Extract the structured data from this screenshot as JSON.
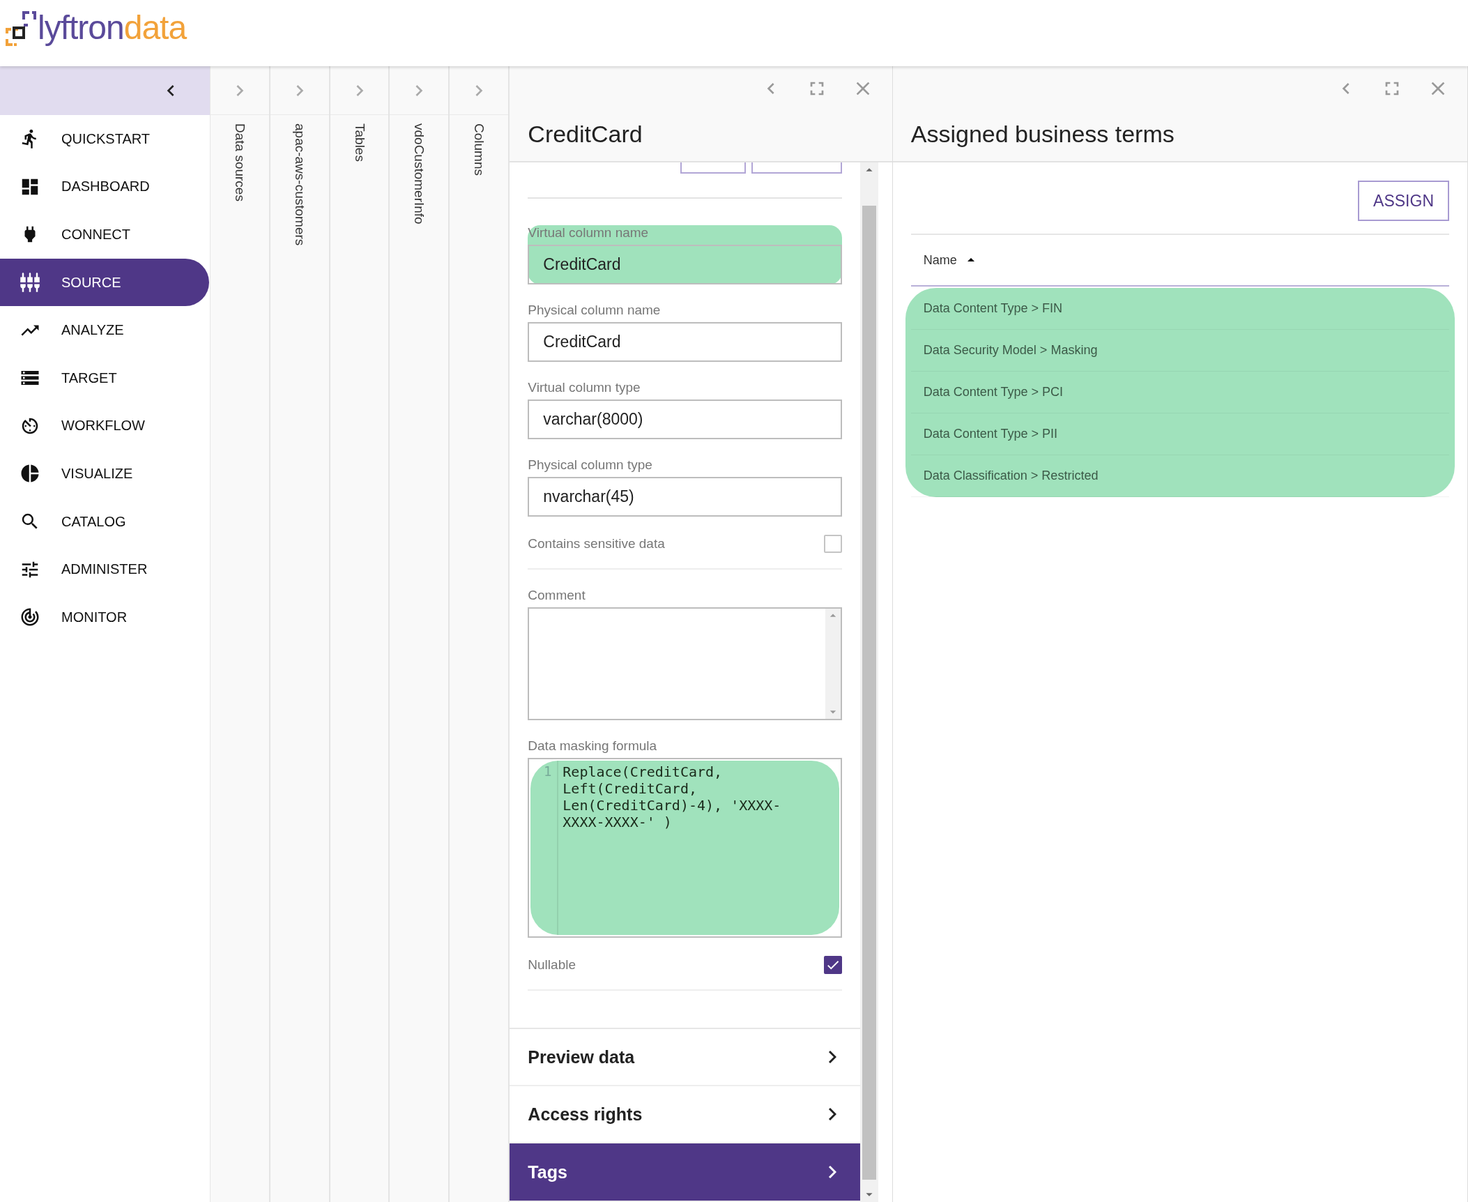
{
  "logo": {
    "first": "lyftron",
    "second": "data"
  },
  "sidebar": {
    "items": [
      {
        "label": "QUICKSTART",
        "selected": false
      },
      {
        "label": "DASHBOARD",
        "selected": false
      },
      {
        "label": "CONNECT",
        "selected": false
      },
      {
        "label": "SOURCE",
        "selected": true
      },
      {
        "label": "ANALYZE",
        "selected": false
      },
      {
        "label": "TARGET",
        "selected": false
      },
      {
        "label": "WORKFLOW",
        "selected": false
      },
      {
        "label": "VISUALIZE",
        "selected": false
      },
      {
        "label": "CATALOG",
        "selected": false
      },
      {
        "label": "ADMINISTER",
        "selected": false
      },
      {
        "label": "MONITOR",
        "selected": false
      }
    ]
  },
  "collapsed_panels": [
    "Data sources",
    "apac-aws-customers",
    "Tables",
    "vdoCustomerInfo",
    "Columns"
  ],
  "detail_panel": {
    "title": "CreditCard",
    "fields": [
      {
        "kind": "text",
        "label": "Virtual column name",
        "value": "CreditCard",
        "highlighted": true
      },
      {
        "kind": "text",
        "label": "Physical column name",
        "value": "CreditCard",
        "highlighted": false
      },
      {
        "kind": "text",
        "label": "Virtual column type",
        "value": "varchar(8000)",
        "highlighted": false
      },
      {
        "kind": "text",
        "label": "Physical column type",
        "value": "nvarchar(45)",
        "highlighted": false
      },
      {
        "kind": "checkbox",
        "label": "Contains sensitive data",
        "checked": false
      },
      {
        "kind": "textarea",
        "label": "Comment"
      },
      {
        "kind": "code",
        "label": "Data masking formula",
        "line_number": "1",
        "value": "Replace(CreditCard, Left(CreditCard, Len(CreditCard)-4), 'XXXX-XXXX-XXXX-' )",
        "highlighted": true
      },
      {
        "kind": "checkbox",
        "label": "Nullable",
        "checked": true
      }
    ],
    "sections": [
      {
        "label": "Preview data",
        "selected": false
      },
      {
        "label": "Access rights",
        "selected": false
      },
      {
        "label": "Tags",
        "selected": true
      }
    ]
  },
  "terms_panel": {
    "title": "Assigned business terms",
    "assign_button": "ASSIGN",
    "column": "Name",
    "highlighted": true,
    "rows": [
      "Data Content Type > FIN",
      "Data Security Model > Masking",
      "Data Content Type > PCI",
      "Data Content Type > PII",
      "Data Classification > Restricted"
    ]
  }
}
